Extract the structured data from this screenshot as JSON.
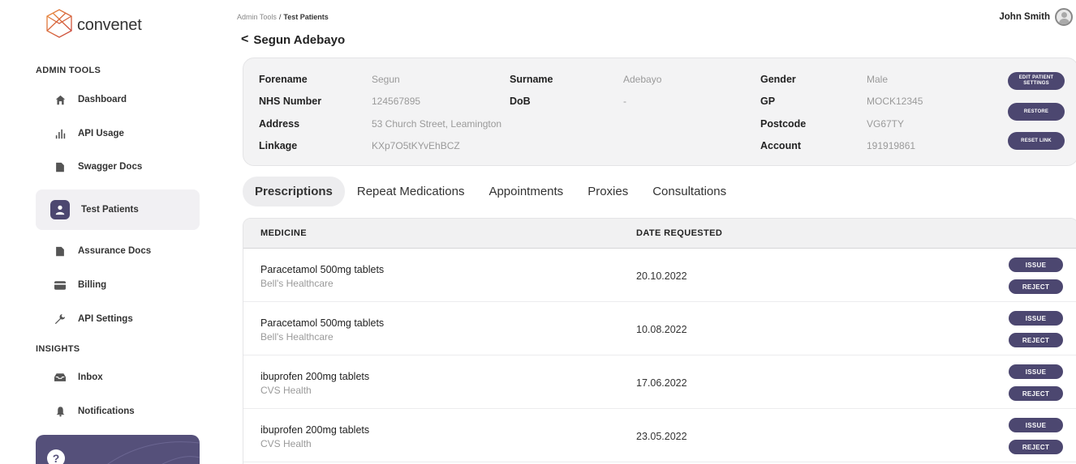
{
  "brand": {
    "name": "convenet",
    "accent": "#4c4770"
  },
  "sidebar": {
    "admin_section": "ADMIN TOOLS",
    "insights_section": "INSIGHTS",
    "admin_items": [
      {
        "label": "Dashboard",
        "icon": "home-icon"
      },
      {
        "label": "API Usage",
        "icon": "bar-chart-icon"
      },
      {
        "label": "Swagger Docs",
        "icon": "document-icon"
      },
      {
        "label": "Test Patients",
        "icon": "user-icon",
        "active": true
      },
      {
        "label": "Assurance Docs",
        "icon": "document-icon"
      },
      {
        "label": "Billing",
        "icon": "credit-card-icon"
      },
      {
        "label": "API Settings",
        "icon": "wrench-icon"
      }
    ],
    "insights_items": [
      {
        "label": "Inbox",
        "icon": "inbox-icon"
      },
      {
        "label": "Notifications",
        "icon": "bell-icon"
      }
    ],
    "help_glyph": "?"
  },
  "header": {
    "breadcrumb": {
      "parent": "Admin Tools",
      "separator": "/",
      "current": "Test Patients"
    },
    "back_glyph": "<",
    "title": "Segun Adebayo",
    "user_name": "John Smith"
  },
  "patient": {
    "forename_label": "Forename",
    "forename": "Segun",
    "surname_label": "Surname",
    "surname": "Adebayo",
    "gender_label": "Gender",
    "gender": "Male",
    "nhs_label": "NHS Number",
    "nhs": "124567895",
    "dob_label": "DoB",
    "dob": "-",
    "gp_label": "GP",
    "gp": "MOCK12345",
    "address_label": "Address",
    "address": "53 Church Street, Leamington",
    "postcode_label": "Postcode",
    "postcode": "VG67TY",
    "linkage_label": "Linkage",
    "linkage": "KXp7O5tKYvEhBCZ",
    "account_label": "Account",
    "account": "191919861",
    "buttons": {
      "edit": "EDIT PATIENT SETTINGS",
      "restore": "RESTORE",
      "reset": "RESET LINK"
    }
  },
  "tabs": [
    "Prescriptions",
    "Repeat Medications",
    "Appointments",
    "Proxies",
    "Consultations"
  ],
  "table": {
    "columns": [
      "MEDICINE",
      "DATE REQUESTED"
    ],
    "issue_label": "ISSUE",
    "reject_label": "REJECT",
    "rows": [
      {
        "medicine": "Paracetamol 500mg tablets",
        "pharmacy": "Bell's Healthcare",
        "date": "20.10.2022"
      },
      {
        "medicine": "Paracetamol 500mg tablets",
        "pharmacy": "Bell's Healthcare",
        "date": "10.08.2022"
      },
      {
        "medicine": "ibuprofen 200mg tablets",
        "pharmacy": "CVS Health",
        "date": "17.06.2022"
      },
      {
        "medicine": "ibuprofen 200mg tablets",
        "pharmacy": "CVS Health",
        "date": "23.05.2022"
      }
    ]
  }
}
